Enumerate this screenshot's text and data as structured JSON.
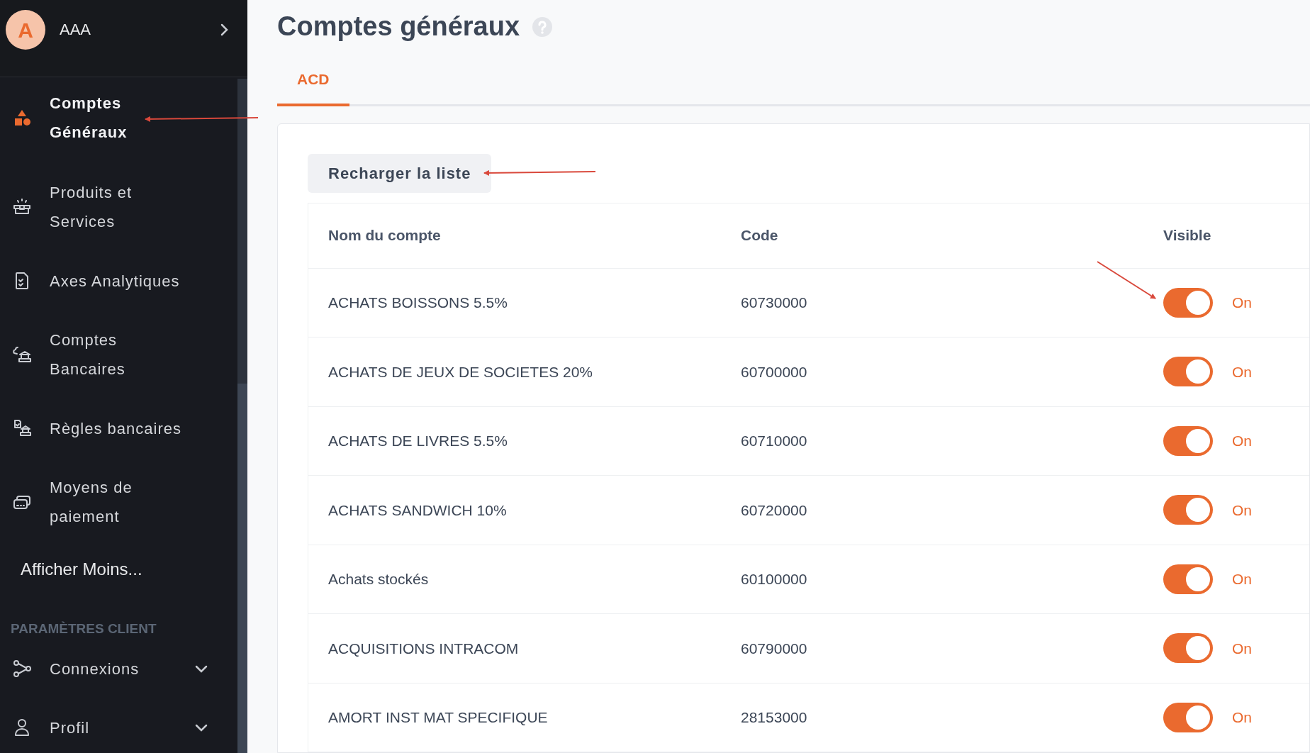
{
  "account": {
    "initial": "A",
    "name": "AAA"
  },
  "sidebar": {
    "items": [
      {
        "label": "Comptes Généraux",
        "selected": true
      },
      {
        "label": "Produits et Services",
        "selected": false
      },
      {
        "label": "Axes Analytiques",
        "selected": false
      },
      {
        "label": "Comptes Bancaires",
        "selected": false
      },
      {
        "label": "Règles bancaires",
        "selected": false
      },
      {
        "label": "Moyens de paiement",
        "selected": false
      }
    ],
    "more_link": "Afficher Moins...",
    "section_title": "PARAMÈTRES CLIENT",
    "section_items": [
      {
        "label": "Connexions",
        "expanded": false
      },
      {
        "label": "Profil",
        "expanded": false
      }
    ]
  },
  "page": {
    "title": "Comptes généraux"
  },
  "tabs": [
    {
      "label": "ACD",
      "selected": true
    }
  ],
  "reload_button": "Recharger la liste",
  "table": {
    "columns": [
      "Nom du compte",
      "Code",
      "Visible"
    ],
    "rows": [
      {
        "name": "ACHATS BOISSONS 5.5%",
        "code": "60730000",
        "visible": true,
        "toggle_label": "On"
      },
      {
        "name": "ACHATS DE JEUX DE SOCIETES 20%",
        "code": "60700000",
        "visible": true,
        "toggle_label": "On"
      },
      {
        "name": "ACHATS DE LIVRES 5.5%",
        "code": "60710000",
        "visible": true,
        "toggle_label": "On"
      },
      {
        "name": "ACHATS SANDWICH 10%",
        "code": "60720000",
        "visible": true,
        "toggle_label": "On"
      },
      {
        "name": "Achats stockés",
        "code": "60100000",
        "visible": true,
        "toggle_label": "On"
      },
      {
        "name": "ACQUISITIONS INTRACOM",
        "code": "60790000",
        "visible": true,
        "toggle_label": "On"
      },
      {
        "name": "AMORT INST MAT SPECIFIQUE",
        "code": "28153000",
        "visible": true,
        "toggle_label": "On"
      }
    ]
  }
}
